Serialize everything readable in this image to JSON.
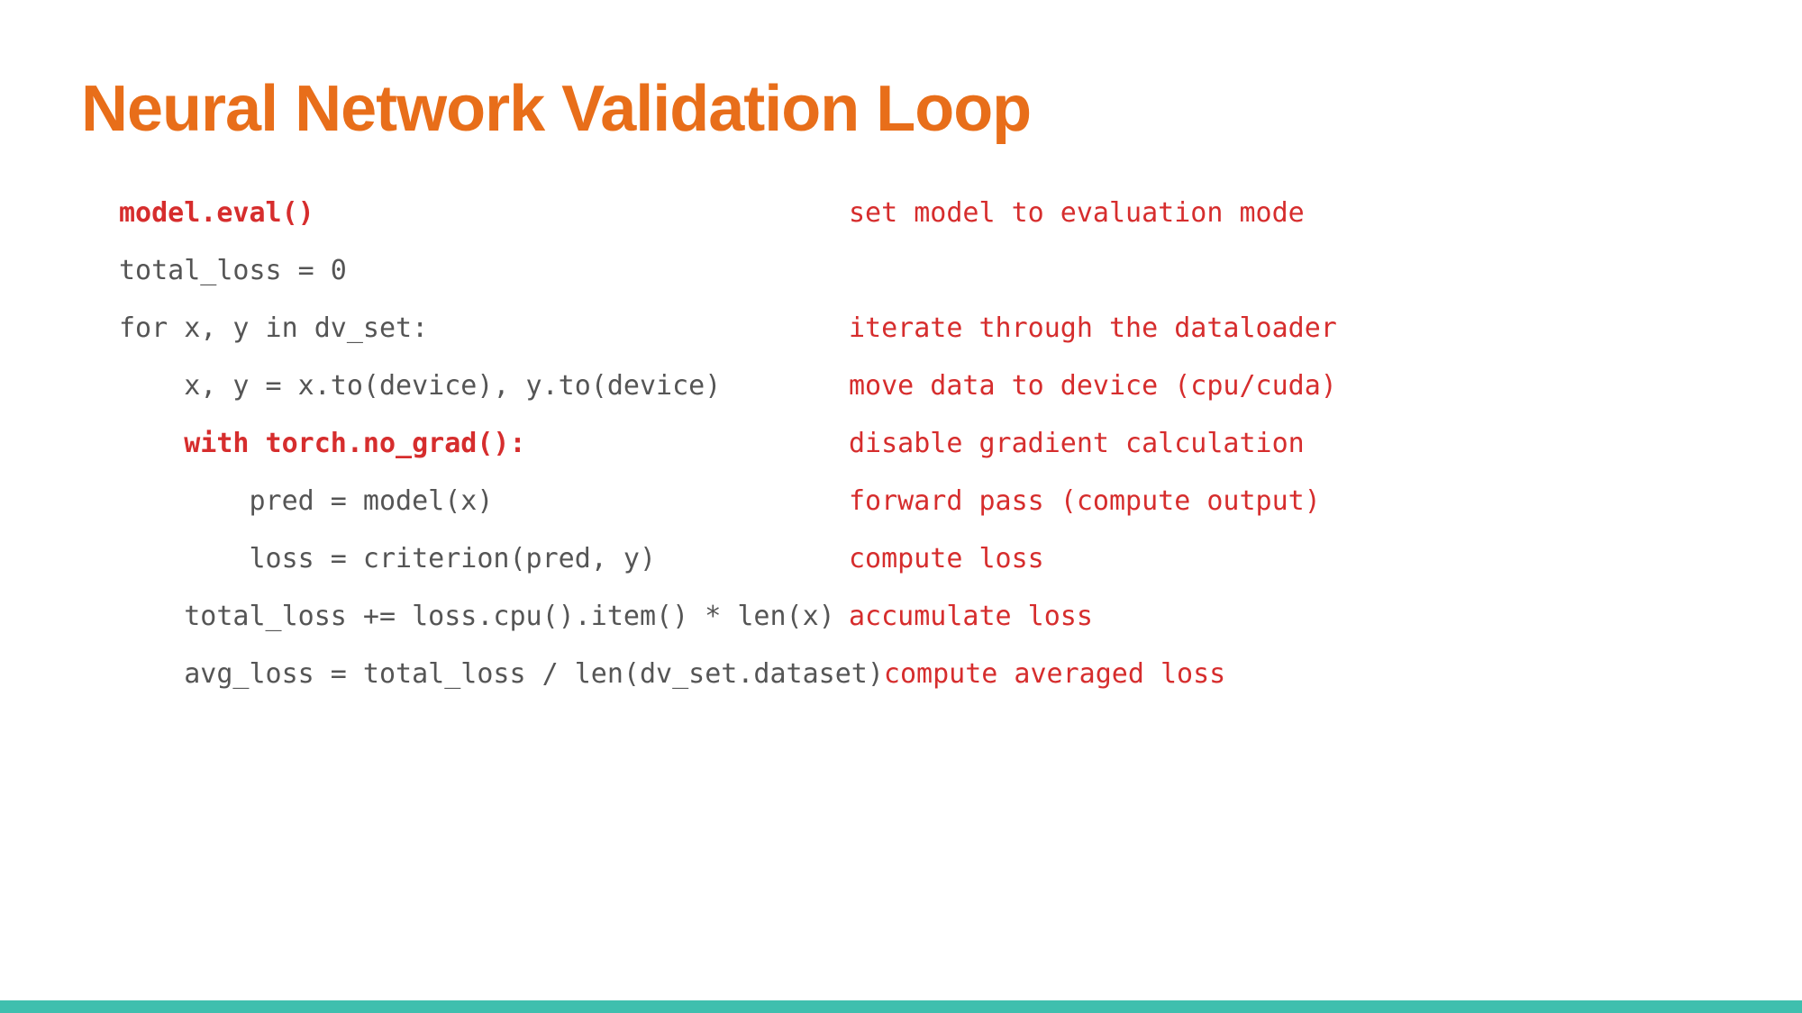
{
  "title": "Neural Network Validation Loop",
  "lines": [
    {
      "code": "model.eval()",
      "bold": true,
      "comment": "set model to evaluation mode"
    },
    {
      "code": "total_loss = 0",
      "bold": false,
      "comment": ""
    },
    {
      "code": "for x, y in dv_set:",
      "bold": false,
      "comment": "iterate through the dataloader"
    },
    {
      "code": "    x, y = x.to(device), y.to(device)",
      "bold": false,
      "comment": "move data to device (cpu/cuda)"
    },
    {
      "code": "    with torch.no_grad():",
      "bold": true,
      "comment": "disable gradient calculation"
    },
    {
      "code": "        pred = model(x)",
      "bold": false,
      "comment": "forward pass (compute output)"
    },
    {
      "code": "        loss = criterion(pred, y)",
      "bold": false,
      "comment": "compute loss"
    },
    {
      "code": "    total_loss += loss.cpu().item() * len(x)",
      "bold": false,
      "comment": "accumulate loss"
    },
    {
      "code": "    avg_loss = total_loss / len(dv_set.dataset)",
      "bold": false,
      "comment": "compute averaged loss"
    }
  ],
  "colors": {
    "accent_orange": "#e86e1a",
    "accent_red": "#d62d2d",
    "footer_teal": "#3fbfae",
    "code_gray": "#555555"
  }
}
